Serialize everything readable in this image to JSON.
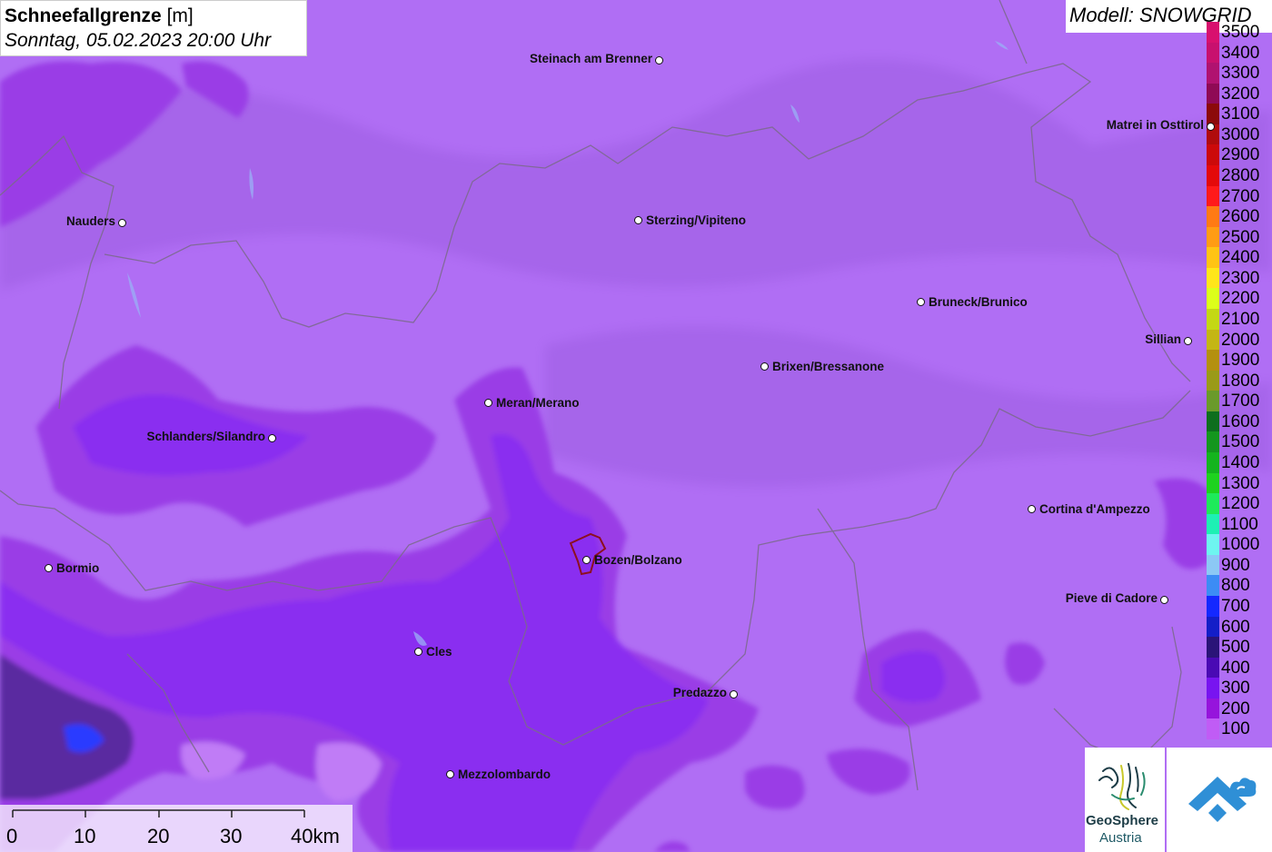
{
  "header": {
    "title_bold": "Schneefallgrenze",
    "title_unit": " [m]",
    "datetime": "Sonntag, 05.02.2023 20:00 Uhr",
    "model": "Modell: SNOWGRID"
  },
  "legend": {
    "items": [
      {
        "value": "3500",
        "color": "#d8106e"
      },
      {
        "value": "3400",
        "color": "#c8106e"
      },
      {
        "value": "3300",
        "color": "#b01270"
      },
      {
        "value": "3200",
        "color": "#8f0a55"
      },
      {
        "value": "3100",
        "color": "#8c0a0a"
      },
      {
        "value": "3000",
        "color": "#b00c0c"
      },
      {
        "value": "2900",
        "color": "#cc0a0a"
      },
      {
        "value": "2800",
        "color": "#e40a0a"
      },
      {
        "value": "2700",
        "color": "#ff1a1a"
      },
      {
        "value": "2600",
        "color": "#ff7a14"
      },
      {
        "value": "2500",
        "color": "#ff9c14"
      },
      {
        "value": "2400",
        "color": "#ffc414"
      },
      {
        "value": "2300",
        "color": "#ffe61a"
      },
      {
        "value": "2200",
        "color": "#dcff1a"
      },
      {
        "value": "2100",
        "color": "#c4d814"
      },
      {
        "value": "2000",
        "color": "#c4b614"
      },
      {
        "value": "1900",
        "color": "#b4900f"
      },
      {
        "value": "1800",
        "color": "#9a9a18"
      },
      {
        "value": "1700",
        "color": "#6a9a2a"
      },
      {
        "value": "1600",
        "color": "#0e6e1e"
      },
      {
        "value": "1500",
        "color": "#14961e"
      },
      {
        "value": "1400",
        "color": "#14b41e"
      },
      {
        "value": "1300",
        "color": "#1ed21e"
      },
      {
        "value": "1200",
        "color": "#1eea5a"
      },
      {
        "value": "1100",
        "color": "#1ef0b4"
      },
      {
        "value": "1000",
        "color": "#6ef5f0"
      },
      {
        "value": "900",
        "color": "#8cc8f5"
      },
      {
        "value": "800",
        "color": "#3c8cf5"
      },
      {
        "value": "700",
        "color": "#1428ff"
      },
      {
        "value": "600",
        "color": "#141ec8"
      },
      {
        "value": "500",
        "color": "#2a1478"
      },
      {
        "value": "400",
        "color": "#4a0ab4"
      },
      {
        "value": "300",
        "color": "#7814f0"
      },
      {
        "value": "200",
        "color": "#9614dc"
      },
      {
        "value": "100",
        "color": "#c05cf5"
      }
    ]
  },
  "cities": [
    {
      "name": "Steinach am Brenner",
      "anchor": "left"
    },
    {
      "name": "Nauders",
      "anchor": "left"
    },
    {
      "name": "Sterzing/Vipiteno",
      "anchor": "right"
    },
    {
      "name": "Matrei in Osttirol",
      "anchor": "left"
    },
    {
      "name": "Bruneck/Brunico",
      "anchor": "right"
    },
    {
      "name": "Sillian",
      "anchor": "left"
    },
    {
      "name": "Brixen/Bressanone",
      "anchor": "right"
    },
    {
      "name": "Meran/Merano",
      "anchor": "right"
    },
    {
      "name": "Schlanders/Silandro",
      "anchor": "left"
    },
    {
      "name": "Cortina d'Ampezzo",
      "anchor": "right"
    },
    {
      "name": "Bozen/Bolzano",
      "anchor": "right"
    },
    {
      "name": "Bormio",
      "anchor": "right"
    },
    {
      "name": "Pieve di Cadore",
      "anchor": "left"
    },
    {
      "name": "Cles",
      "anchor": "right"
    },
    {
      "name": "Predazzo",
      "anchor": "left"
    },
    {
      "name": "Mezzolombardo",
      "anchor": "right"
    }
  ],
  "scale": {
    "ticks": [
      "0",
      "10",
      "20",
      "30",
      "40km"
    ]
  },
  "logos": {
    "geosphere_line1": "GeoSphere",
    "geosphere_line2": "Austria"
  }
}
